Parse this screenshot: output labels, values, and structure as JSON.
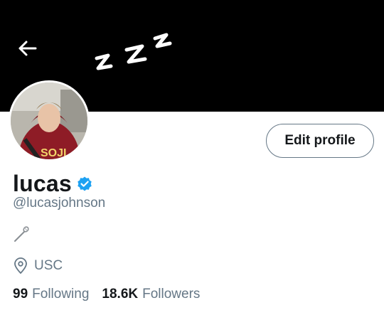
{
  "profile": {
    "display_name": "lucas",
    "handle": "@lucasjohnson",
    "verified": true,
    "bio_emoji": "lacrosse-stick",
    "location": "USC",
    "following_count": "99",
    "following_label": "Following",
    "followers_count": "18.6K",
    "followers_label": "Followers"
  },
  "header": {
    "banner_color": "#000000",
    "banner_glyph": "zzz"
  },
  "actions": {
    "edit_profile_label": "Edit profile"
  },
  "colors": {
    "verified_badge": "#1da1f2",
    "secondary_text": "#657786",
    "primary_text": "#14171a"
  }
}
